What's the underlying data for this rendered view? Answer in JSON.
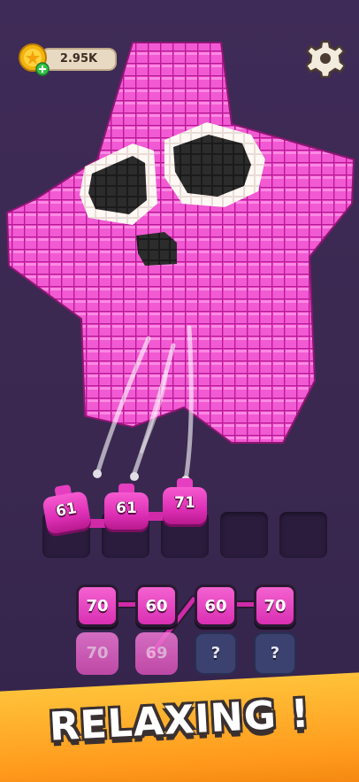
{
  "hud": {
    "coins": "2.95K",
    "coin_icon": "coin-icon",
    "add_icon": "plus-icon",
    "settings_icon": "gear-icon"
  },
  "colors": {
    "creature_pink": "#ea3fc8",
    "background": "#3b2a52",
    "banner": "#ffa423"
  },
  "shooters": [
    {
      "value": "61"
    },
    {
      "value": "61"
    },
    {
      "value": "71"
    }
  ],
  "slots_total": 5,
  "queue": {
    "row1": [
      "70",
      "60",
      "60",
      "70"
    ],
    "row2": [
      "70",
      "69",
      "?",
      "?"
    ]
  },
  "banner": {
    "text": "RELAXING !"
  }
}
